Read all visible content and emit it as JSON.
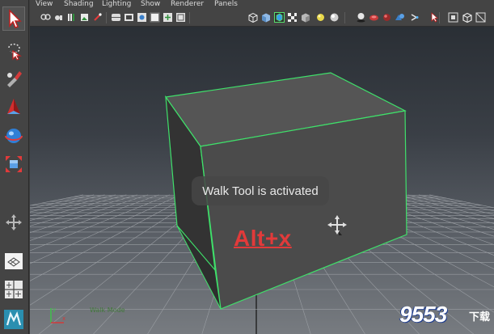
{
  "menubar": {
    "items": [
      "View",
      "Shading",
      "Lighting",
      "Show",
      "Renderer",
      "Panels"
    ]
  },
  "toolbox": {
    "tools": [
      {
        "name": "select-tool-icon"
      },
      {
        "name": "lasso-tool-icon"
      },
      {
        "name": "paint-select-tool-icon"
      },
      {
        "name": "move-tool-icon"
      },
      {
        "name": "rotate-tool-icon"
      },
      {
        "name": "scale-tool-icon"
      },
      {
        "name": "manipulator-icon"
      },
      {
        "name": "layout-single-icon"
      },
      {
        "name": "layout-quad-icon"
      },
      {
        "name": "layout-double-icon"
      },
      {
        "name": "maya-app-icon"
      }
    ]
  },
  "viewport": {
    "tooltip": "Walk Tool is activated",
    "shortcut": "Alt+x",
    "status_line": "Walk Mode",
    "axis": {
      "x": "x",
      "y": "y"
    }
  },
  "watermark": {
    "main": "9553",
    "sub": "下载"
  },
  "colors": {
    "shortcut_red": "#e23a3a",
    "wireframe_green": "#3fe06a",
    "viewport_top": "#2a2f35",
    "viewport_bottom": "#777b80",
    "ui_panel": "#444444"
  }
}
